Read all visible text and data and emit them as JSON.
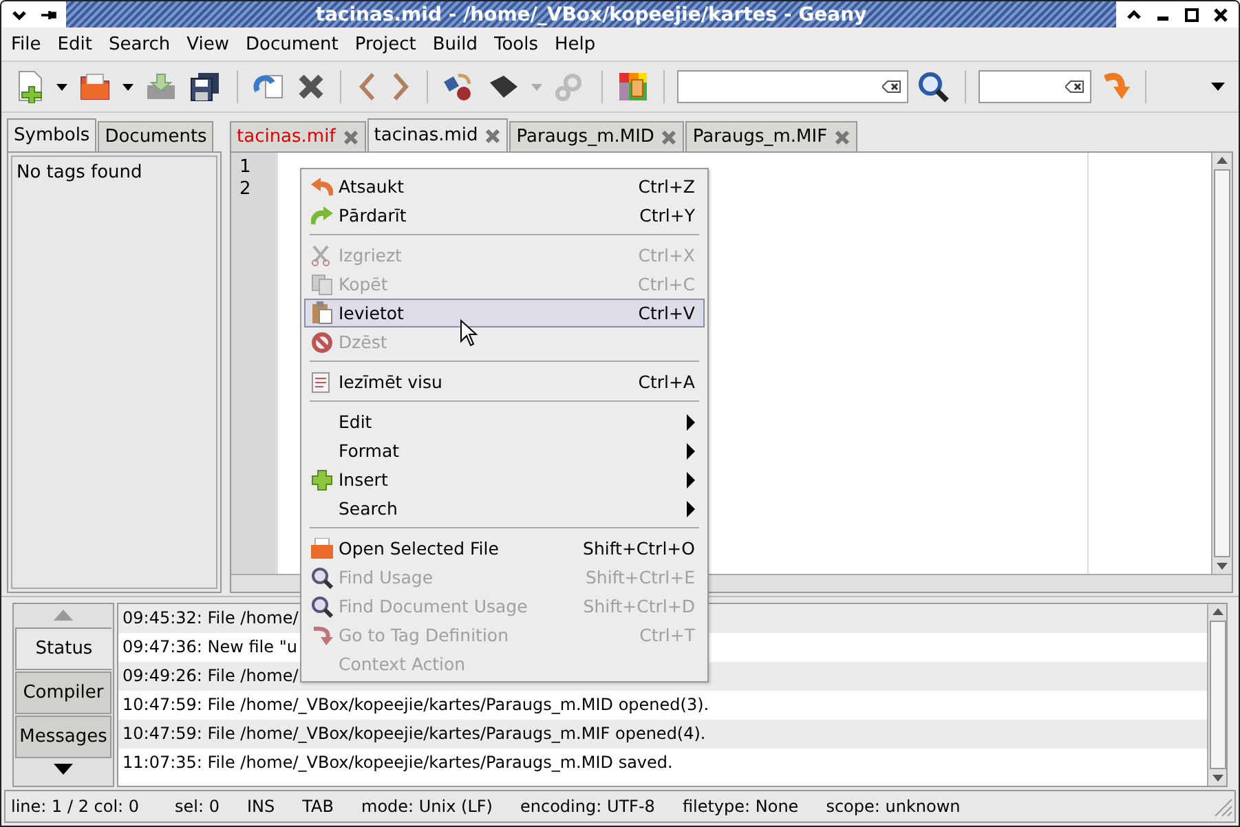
{
  "window": {
    "title": "tacinas.mid - /home/_VBox/kopeejie/kartes - Geany"
  },
  "menubar": [
    "File",
    "Edit",
    "Search",
    "View",
    "Document",
    "Project",
    "Build",
    "Tools",
    "Help"
  ],
  "sidebar": {
    "tabs": [
      {
        "label": "Symbols",
        "selected": true
      },
      {
        "label": "Documents",
        "selected": false
      }
    ],
    "message": "No tags found"
  },
  "editor": {
    "tabs": [
      {
        "label": "tacinas.mif",
        "selected": false,
        "modified": true
      },
      {
        "label": "tacinas.mid",
        "selected": true,
        "modified": false
      },
      {
        "label": "Paraugs_m.MID",
        "selected": false,
        "modified": false
      },
      {
        "label": "Paraugs_m.MIF",
        "selected": false,
        "modified": false
      }
    ],
    "line_numbers": [
      "1",
      "2"
    ]
  },
  "context_menu": {
    "items": [
      {
        "kind": "item",
        "label": "Atsaukt",
        "shortcut": "Ctrl+Z",
        "disabled": false,
        "selected": false
      },
      {
        "kind": "item",
        "label": "Pārdarīt",
        "shortcut": "Ctrl+Y",
        "disabled": false,
        "selected": false
      },
      {
        "kind": "separator"
      },
      {
        "kind": "item",
        "label": "Izgriezt",
        "shortcut": "Ctrl+X",
        "disabled": true,
        "selected": false
      },
      {
        "kind": "item",
        "label": "Kopēt",
        "shortcut": "Ctrl+C",
        "disabled": true,
        "selected": false
      },
      {
        "kind": "item",
        "label": "Ievietot",
        "shortcut": "Ctrl+V",
        "disabled": false,
        "selected": true
      },
      {
        "kind": "item",
        "label": "Dzēst",
        "disabled": true,
        "selected": false
      },
      {
        "kind": "separator"
      },
      {
        "kind": "item",
        "label": "Iezīmēt visu",
        "shortcut": "Ctrl+A",
        "disabled": false,
        "selected": false
      },
      {
        "kind": "separator"
      },
      {
        "kind": "submenu",
        "label": "Edit",
        "disabled": false,
        "selected": false
      },
      {
        "kind": "submenu",
        "label": "Format",
        "disabled": false,
        "selected": false
      },
      {
        "kind": "submenu",
        "label": "Insert",
        "disabled": false,
        "selected": false
      },
      {
        "kind": "submenu",
        "label": "Search",
        "disabled": false,
        "selected": false
      },
      {
        "kind": "separator"
      },
      {
        "kind": "item",
        "label": "Open Selected File",
        "shortcut": "Shift+Ctrl+O",
        "disabled": false,
        "selected": false
      },
      {
        "kind": "item",
        "label": "Find Usage",
        "shortcut": "Shift+Ctrl+E",
        "disabled": true,
        "selected": false
      },
      {
        "kind": "item",
        "label": "Find Document Usage",
        "shortcut": "Shift+Ctrl+D",
        "disabled": true,
        "selected": false
      },
      {
        "kind": "item",
        "label": "Go to Tag Definition",
        "shortcut": "Ctrl+T",
        "disabled": true,
        "selected": false
      },
      {
        "kind": "item",
        "label": "Context Action",
        "disabled": true,
        "selected": false
      }
    ]
  },
  "message_window": {
    "tabs": [
      {
        "label": "Status",
        "selected": true
      },
      {
        "label": "Compiler",
        "selected": false
      },
      {
        "label": "Messages",
        "selected": false
      }
    ],
    "log": [
      "09:45:32: File /home/",
      "09:47:36: New file \"u",
      "09:49:26: File /home/",
      "10:47:59: File /home/_VBox/kopeejie/kartes/Paraugs_m.MID opened(3).",
      "10:47:59: File /home/_VBox/kopeejie/kartes/Paraugs_m.MIF opened(4).",
      "11:07:35: File /home/_VBox/kopeejie/kartes/Paraugs_m.MID saved."
    ]
  },
  "status_bar": [
    "line: 1 / 2  col: 0",
    "sel: 0",
    "INS",
    "TAB",
    "mode: Unix (LF)",
    "encoding: UTF-8",
    "filetype: None",
    "scope: unknown"
  ]
}
